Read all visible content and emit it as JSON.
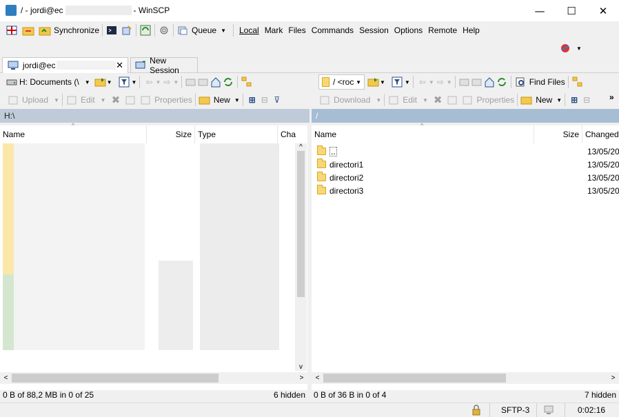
{
  "window": {
    "title": "/ - jordi@ec",
    "title_suffix": "- WinSCP",
    "minimize": "—",
    "maximize": "☐",
    "close": "✕"
  },
  "toolbar": {
    "synchronize_label": "Synchronize",
    "queue_label": "Queue"
  },
  "menu": [
    "Local",
    "Mark",
    "Files",
    "Commands",
    "Session",
    "Options",
    "Remote",
    "Help"
  ],
  "tabs": {
    "session_label": "jordi@ec",
    "new_session_label": "New Session"
  },
  "left_pane": {
    "drive_label": "H: Documents (\\",
    "upload_label": "Upload",
    "edit_label": "Edit",
    "properties_label": "Properties",
    "new_label": "New",
    "path": "H:\\",
    "columns": [
      "Name",
      "Size",
      "Type",
      "Cha"
    ],
    "status_left": "0 B of 88,2 MB in 0 of 25",
    "status_right": "6 hidden"
  },
  "right_pane": {
    "path_label": "/ <roc",
    "find_files_label": "Find Files",
    "download_label": "Download",
    "edit_label": "Edit",
    "properties_label": "Properties",
    "new_label": "New",
    "path": "/",
    "columns": [
      "Name",
      "Size",
      "Changed"
    ],
    "files": [
      {
        "name": "..",
        "changed": "13/05/20"
      },
      {
        "name": "directori1",
        "changed": "13/05/20"
      },
      {
        "name": "directori2",
        "changed": "13/05/20"
      },
      {
        "name": "directori3",
        "changed": "13/05/20"
      }
    ],
    "status_left": "0 B of 36 B in 0 of 4",
    "status_right": "7 hidden"
  },
  "statusbar": {
    "protocol": "SFTP-3",
    "elapsed": "0:02:16"
  },
  "colors": {
    "path_active": "#a6bdd4",
    "path_inactive": "#bfcbd8",
    "folder": "#f8d776"
  }
}
